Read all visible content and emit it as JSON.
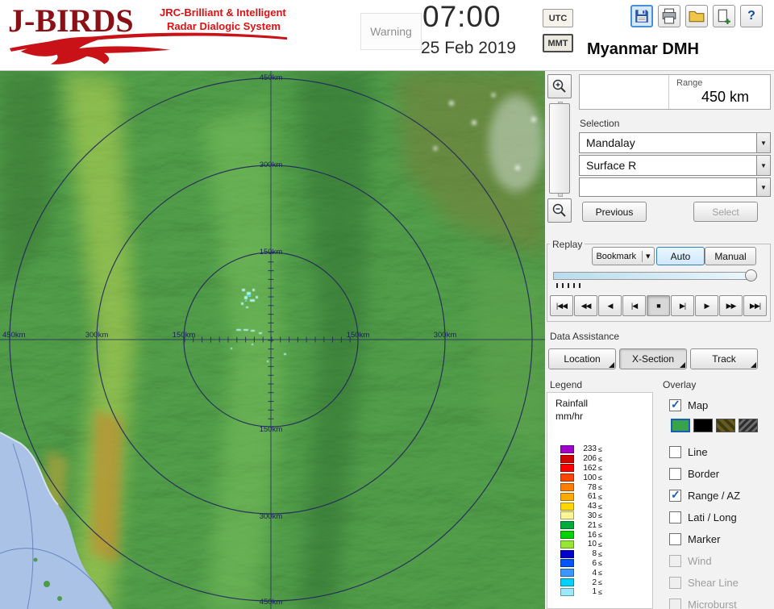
{
  "header": {
    "title": "J-BIRDS",
    "subtitle1": "JRC-Brilliant & Intelligent",
    "subtitle2": "Radar  Dialogic System",
    "warning": "Warning",
    "time": "07:00",
    "date": "25 Feb 2019",
    "utc": "UTC",
    "mmt": "MMT",
    "help": "?",
    "org": "Myanmar DMH"
  },
  "icons": {
    "arrow_down": "▾",
    "combo_arrow": "▼",
    "save": "save-icon",
    "print": "print-icon",
    "folder": "open-folder-icon",
    "export": "new-document-icon",
    "help": "help-icon",
    "zoom_in": "zoom-in-icon",
    "zoom_out": "zoom-out-icon"
  },
  "range": {
    "label": "Range",
    "value": "450 km"
  },
  "selection": {
    "label": "Selection",
    "site": "Mandalay",
    "product": "Surface R",
    "product2": "",
    "previous": "Previous",
    "select": "Select"
  },
  "replay": {
    "label": "Replay",
    "bookmark": "Bookmark",
    "auto": "Auto",
    "manual": "Manual"
  },
  "transport": {
    "buttons": [
      "|◀◀",
      "◀◀",
      "◀",
      "|◀",
      "■",
      "▶|",
      "▶",
      "▶▶",
      "▶▶|"
    ]
  },
  "assistance": {
    "label": "Data Assistance",
    "location": "Location",
    "xsection": "X-Section",
    "track": "Track"
  },
  "legend": {
    "label": "Legend",
    "title": "Rainfall",
    "units": "mm/hr",
    "le": "≤",
    "rows": [
      {
        "v": "233",
        "c": "#a000c8"
      },
      {
        "v": "206",
        "c": "#d20000"
      },
      {
        "v": "162",
        "c": "#ff0000"
      },
      {
        "v": "100",
        "c": "#ff4600"
      },
      {
        "v": "78",
        "c": "#ff7d00"
      },
      {
        "v": "61",
        "c": "#ffaa00"
      },
      {
        "v": "43",
        "c": "#ffd700"
      },
      {
        "v": "30",
        "c": "#fdf596"
      },
      {
        "v": "21",
        "c": "#00aa3c"
      },
      {
        "v": "16",
        "c": "#00d200"
      },
      {
        "v": "10",
        "c": "#96e632"
      },
      {
        "v": "8",
        "c": "#0000c8"
      },
      {
        "v": "6",
        "c": "#0055ff"
      },
      {
        "v": "4",
        "c": "#3c96ff"
      },
      {
        "v": "2",
        "c": "#00d2ff"
      },
      {
        "v": "1",
        "c": "#9be9ff"
      }
    ]
  },
  "overlay": {
    "label": "Overlay",
    "map_item": {
      "label": "Map",
      "checked": true
    },
    "styles": [
      {
        "name": "terrain-green",
        "color": "#37a34a",
        "selected": true
      },
      {
        "name": "plain-black",
        "color": "#000000"
      },
      {
        "name": "camo",
        "color": "#5a4f1e"
      },
      {
        "name": "hatch",
        "color": "#4a4a4a"
      }
    ],
    "items": [
      {
        "label": "Line",
        "checked": false
      },
      {
        "label": "Border",
        "checked": false
      },
      {
        "label": "Range / AZ",
        "checked": true
      },
      {
        "label": "Lati / Long",
        "checked": false
      },
      {
        "label": "Marker",
        "checked": false
      },
      {
        "label": "Wind",
        "checked": false,
        "disabled": true
      },
      {
        "label": "Shear Line",
        "checked": false,
        "disabled": true
      },
      {
        "label": "Microburst",
        "checked": false,
        "disabled": true
      }
    ]
  },
  "map": {
    "r150": "150km",
    "r300": "300km",
    "r450": "450km",
    "ring_color": "#23275e",
    "echo_color": "#a8f4ee"
  }
}
